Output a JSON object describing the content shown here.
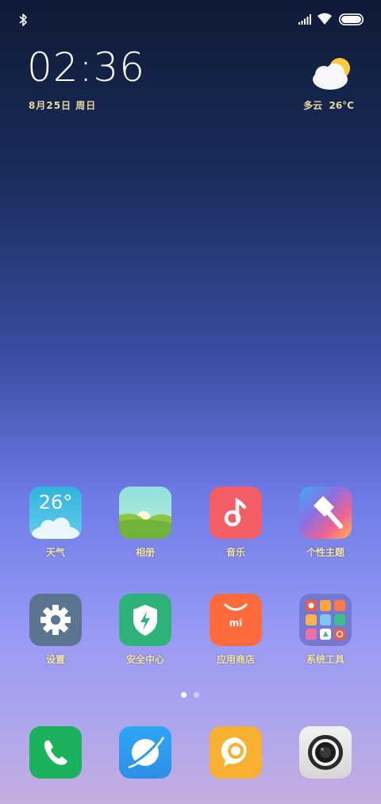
{
  "status_bar": {
    "icons": [
      "bluetooth-icon",
      "signal-icon",
      "wifi-icon",
      "battery-icon"
    ]
  },
  "clock": {
    "time": "02:36",
    "date": "8月25日 周日"
  },
  "weather": {
    "condition": "多云",
    "temperature": "26°C",
    "icon": "partly-cloudy-icon"
  },
  "apps_row1": [
    {
      "label": "天气",
      "icon": "weather-app-icon",
      "icon_text": "26°",
      "color": "#36b7de"
    },
    {
      "label": "相册",
      "icon": "gallery-app-icon",
      "color": "#8bd3c3"
    },
    {
      "label": "音乐",
      "icon": "music-app-icon",
      "color": "#f25a63"
    },
    {
      "label": "个性主题",
      "icon": "themes-app-icon",
      "color": "#7b6de0"
    }
  ],
  "apps_row2": [
    {
      "label": "设置",
      "icon": "settings-app-icon",
      "color": "#5b7590"
    },
    {
      "label": "安全中心",
      "icon": "security-app-icon",
      "color": "#2fb27a"
    },
    {
      "label": "应用商店",
      "icon": "app-store-icon",
      "icon_text": "mi",
      "color": "#ff6a3d"
    },
    {
      "label": "系统工具",
      "icon": "tools-folder-icon",
      "color": "#6c72c8"
    }
  ],
  "dock": [
    {
      "name": "phone",
      "icon": "phone-icon",
      "color": "#1ab35b"
    },
    {
      "name": "browser",
      "icon": "browser-icon",
      "color": "#2a9ef0"
    },
    {
      "name": "messages",
      "icon": "messages-icon",
      "color": "#f7b02f"
    },
    {
      "name": "camera",
      "icon": "camera-icon",
      "color": "#e6e6e6"
    }
  ],
  "pager": {
    "pages": 2,
    "current": 1
  }
}
